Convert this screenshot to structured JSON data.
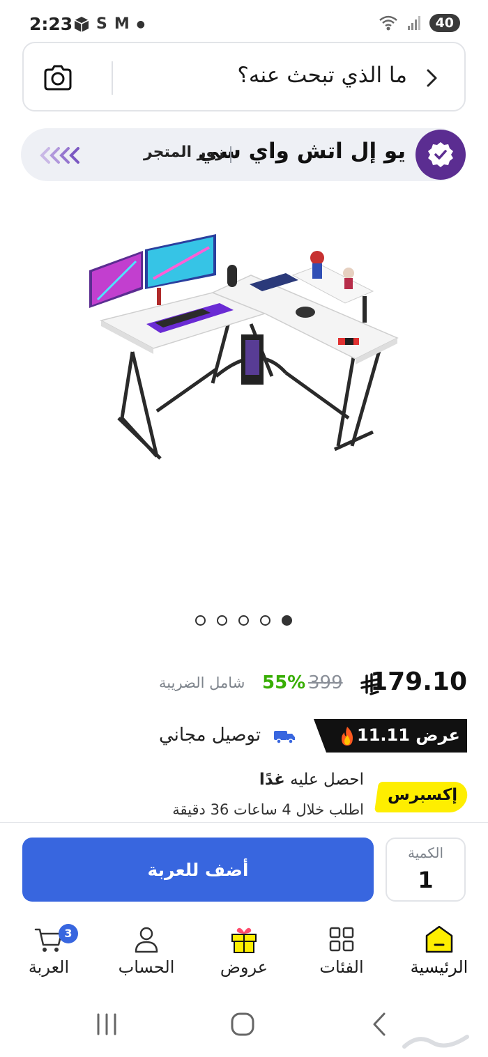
{
  "status_bar": {
    "time": "2:23",
    "icons": [
      "package-icon",
      "s-icon",
      "mail-icon",
      "dot"
    ],
    "s_letter": "S",
    "mail_letter": "M",
    "battery": "40"
  },
  "search": {
    "placeholder": "ما الذي تبحث عنه؟"
  },
  "store": {
    "name": "يو إل اتش واي سي",
    "visit_label": "زور المتجر",
    "badge_color": "#5b2d91"
  },
  "gallery": {
    "total_images": 5,
    "active_index": 4
  },
  "product": {
    "price": "179.10",
    "currency_icon": "riyal-icon",
    "old_price": "399",
    "discount": "55%",
    "tax_note": "شامل الضريبة",
    "offer_label": "عرض 11.11",
    "free_delivery": "توصيل مجاني",
    "express_label": "إكسبرس",
    "get_it_prefix": "احصل عليه ",
    "get_it_day": "غدًا",
    "order_within": "اطلب خلال 4 ساعات 36 دقيقة"
  },
  "cart_panel": {
    "add_to_cart": "أضف للعربة",
    "quantity_label": "الكمية",
    "quantity_value": "1"
  },
  "bottom_nav": {
    "items": [
      {
        "label": "الرئيسية",
        "icon": "home-icon",
        "active": true
      },
      {
        "label": "الفئات",
        "icon": "categories-icon",
        "active": false
      },
      {
        "label": "عروض",
        "icon": "offers-gift-icon",
        "active": false
      },
      {
        "label": "الحساب",
        "icon": "account-icon",
        "active": false
      },
      {
        "label": "العربة",
        "icon": "cart-icon",
        "active": false,
        "badge": "3"
      }
    ]
  },
  "colors": {
    "accent_blue": "#3866df",
    "express_yellow": "#feee00",
    "discount_green": "#38ae04"
  }
}
